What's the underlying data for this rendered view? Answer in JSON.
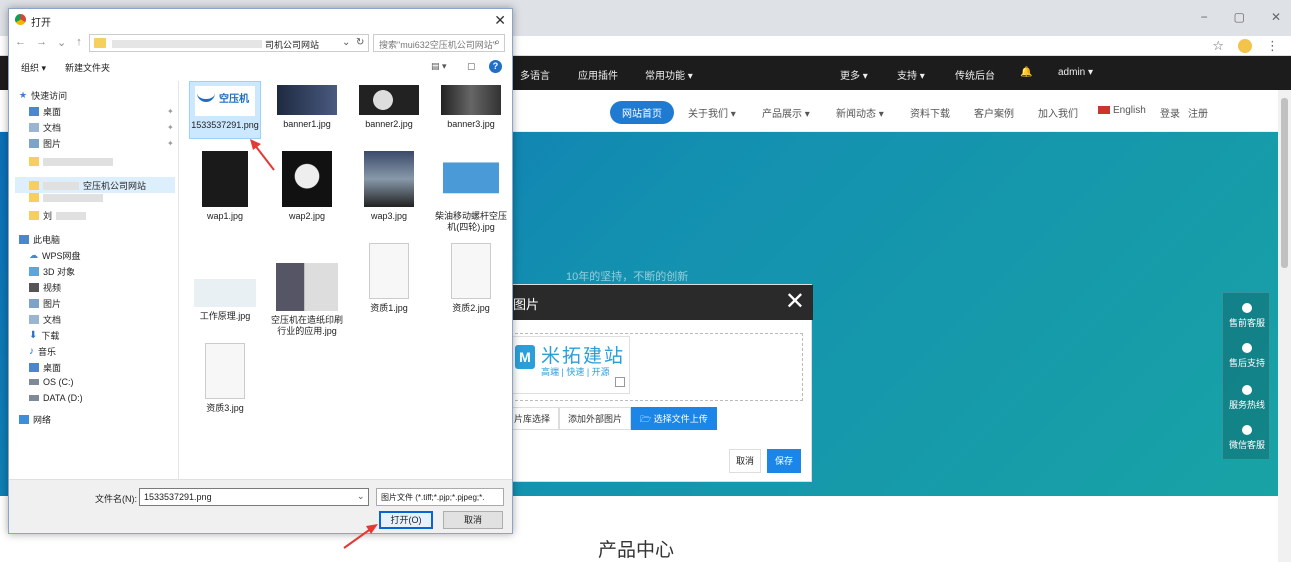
{
  "browser": {
    "win_controls": [
      "−",
      "▢",
      "✕"
    ],
    "addr_icons": [
      "star-icon",
      "avatar",
      "menu-icon"
    ]
  },
  "admin_bar": {
    "items": [
      "多语言",
      "应用插件",
      "常用功能 ▾",
      "更多 ▾",
      "支持 ▾",
      "传统后台",
      "🔔",
      "admin ▾"
    ]
  },
  "site_nav": {
    "items": [
      "网站首页",
      "关于我们 ▾",
      "产品展示 ▾",
      "新闻动态 ▾",
      "资料下载",
      "客户案例",
      "加入我们",
      "English",
      "登录",
      "注册"
    ]
  },
  "banner": {
    "text": "10年的坚持，不断的创新"
  },
  "float_bar": {
    "items": [
      "售前客服",
      "售后支持",
      "服务热线",
      "微信客服"
    ]
  },
  "section": {
    "title": "产品中心"
  },
  "image_modal": {
    "title": "图片",
    "close": "✕",
    "thumb_name": "米拓建站",
    "thumb_sub": "高端 | 快速 | 开源",
    "btn_library": "片库选择",
    "btn_external": "添加外部图片",
    "btn_upload": "选择文件上传",
    "btn_cancel": "取消",
    "btn_save": "保存"
  },
  "open_dialog": {
    "title": "打开",
    "close": "✕",
    "address_tail": "司机公司网站",
    "search_placeholder": "搜索\"mui632空压机公司网站\"",
    "toolbar": {
      "organize": "组织 ▾",
      "new_folder": "新建文件夹"
    },
    "nav": {
      "quick_access": "快速访问",
      "desktop": "桌面",
      "documents": "文档",
      "pictures": "图片",
      "selected_folder": "空压机公司网站",
      "blurred_folder": "刘",
      "this_pc": "此电脑",
      "wps": "WPS网盘",
      "objects3d": "3D 对象",
      "videos": "视频",
      "pc_pictures": "图片",
      "pc_documents": "文档",
      "downloads": "下载",
      "music": "音乐",
      "pc_desktop": "桌面",
      "drive_c": "OS (C:)",
      "drive_d": "DATA (D:)",
      "network": "网络"
    },
    "files": [
      "1533537291.png",
      "banner1.jpg",
      "banner2.jpg",
      "banner3.jpg",
      "wap1.jpg",
      "wap2.jpg",
      "wap3.jpg",
      "柴油移动螺杆空压机(四轮).jpg",
      "工作原理.jpg",
      "空压机在造纸印刷行业的应用.jpg",
      "资质1.jpg",
      "资质2.jpg",
      "资质3.jpg"
    ],
    "file1_thumb_text": "空压机",
    "filename_label": "文件名(N):",
    "filename_value": "1533537291.png",
    "filetype": "图片文件 (*.tiff;*.pjp;*.pjpeg;*.",
    "btn_open": "打开(O)",
    "btn_cancel": "取消"
  },
  "colors": {
    "admin_bar": "#1c1c1c",
    "banner_start": "#0c6fb8",
    "banner_end": "#18a3a5",
    "accent_blue": "#1c86e8",
    "annotation_red": "#e53935"
  }
}
